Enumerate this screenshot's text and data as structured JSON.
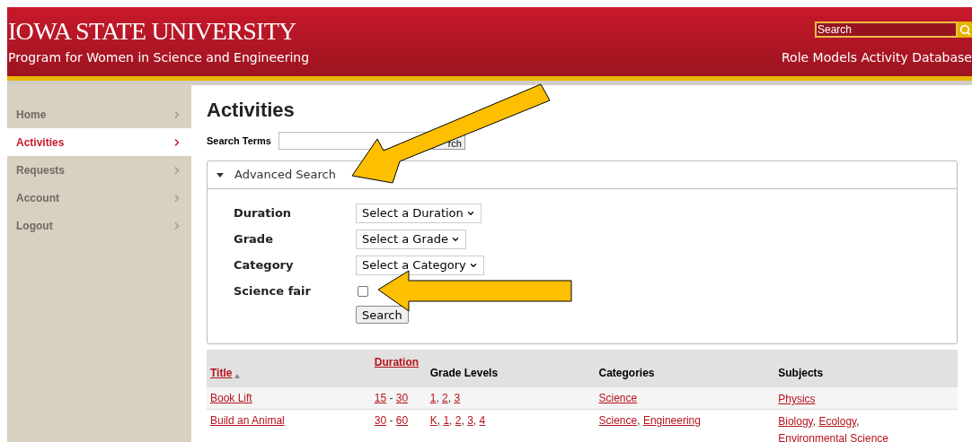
{
  "header": {
    "logo": "IOWA STATE UNIVERSITY",
    "subtitle": "Program for Women in Science and Engineering",
    "site_title": "Role Models Activity Database",
    "search": {
      "value": "Search"
    }
  },
  "sidebar": {
    "items": [
      {
        "label": "Home",
        "selected": false
      },
      {
        "label": "Activities",
        "selected": true
      },
      {
        "label": "Requests",
        "selected": false
      },
      {
        "label": "Account",
        "selected": false
      },
      {
        "label": "Logout",
        "selected": false
      }
    ]
  },
  "page": {
    "title": "Activities",
    "search_terms": {
      "label": "Search Terms",
      "button": "rch"
    }
  },
  "advanced_search": {
    "title": "Advanced Search",
    "expanded": true,
    "fields": [
      {
        "kind": "select",
        "label": "Duration",
        "value": "Select a Duration"
      },
      {
        "kind": "select",
        "label": "Grade",
        "value": "Select a Grade"
      },
      {
        "kind": "select",
        "label": "Category",
        "value": "Select a Category"
      },
      {
        "kind": "checkbox",
        "label": "Science fair",
        "checked": false
      }
    ],
    "button": "Search"
  },
  "table": {
    "list_separator": ",",
    "range_separator": "-",
    "columns": [
      {
        "label": "Title",
        "link": true,
        "sorted": true
      },
      {
        "label": "Duration",
        "link": true,
        "sorted": false
      },
      {
        "label": "Grade Levels",
        "link": false,
        "sorted": false
      },
      {
        "label": "Categories",
        "link": false,
        "sorted": false
      },
      {
        "label": "Subjects",
        "link": false,
        "sorted": false
      }
    ],
    "rows": [
      {
        "title": "Book Lift",
        "duration": [
          "15",
          "30"
        ],
        "grades": [
          "1",
          "2",
          "3"
        ],
        "categories": [
          "Science"
        ],
        "subjects": [
          "Physics"
        ]
      },
      {
        "title": "Build an Animal",
        "duration": [
          "30",
          "60"
        ],
        "grades": [
          "K",
          "1",
          "2",
          "3",
          "4"
        ],
        "categories": [
          "Science",
          "Engineering"
        ],
        "subjects": [
          "Biology",
          "Ecology",
          "Environmental Science"
        ]
      }
    ]
  }
}
